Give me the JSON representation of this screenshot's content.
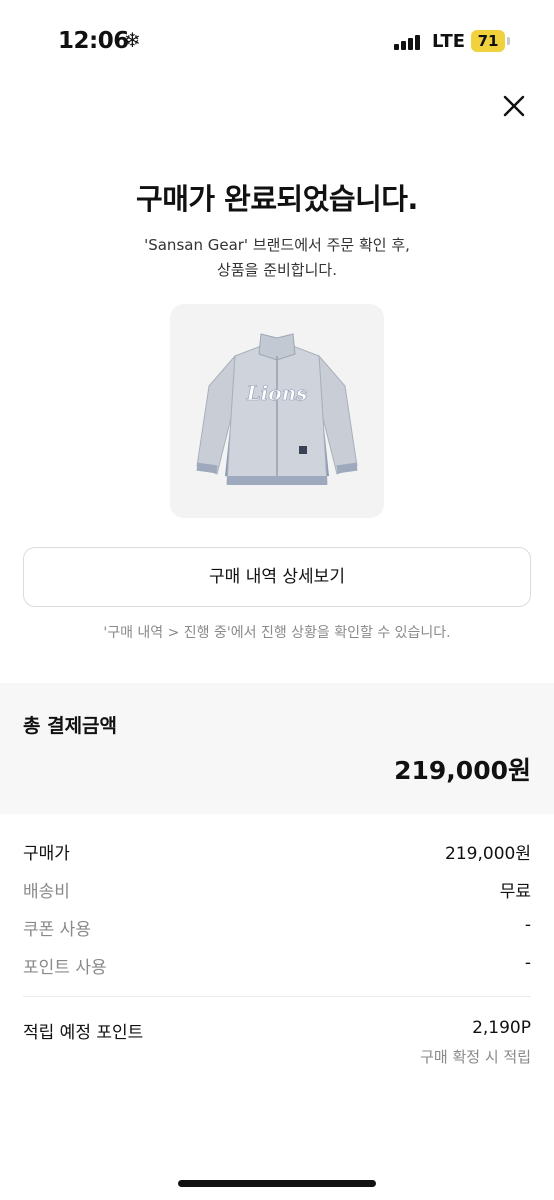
{
  "status_bar": {
    "time": "12:06",
    "network": "LTE",
    "battery": "71",
    "icons": [
      "snowflake-icon",
      "signal-icon",
      "battery-icon"
    ]
  },
  "header": {
    "close_icon": "close-icon"
  },
  "confirmation": {
    "title": "구매가 완료되었습니다.",
    "subtitle_line1": "'Sansan Gear' 브랜드에서 주문 확인 후,",
    "subtitle_line2": "상품을 준비합니다."
  },
  "product": {
    "image": "jacket-product-image",
    "logo_text": "Lions"
  },
  "actions": {
    "detail_button_label": "구매 내역 상세보기",
    "hint": "'구매 내역 > 진행 중'에서 진행 상황을 확인할 수 있습니다."
  },
  "total": {
    "label": "총 결제금액",
    "value": "219,000원"
  },
  "breakdown": [
    {
      "label": "구매가",
      "value": "219,000원"
    },
    {
      "label": "배송비",
      "value": "무료"
    },
    {
      "label": "쿠폰 사용",
      "value": "-"
    },
    {
      "label": "포인트 사용",
      "value": "-"
    }
  ],
  "points": {
    "label": "적립 예정 포인트",
    "value": "2,190P",
    "note": "구매 확정 시 적립"
  },
  "colors": {
    "text": "#111111",
    "muted": "#8a8a8a",
    "section_bg": "#f7f7f7",
    "battery": "#f2d23c"
  }
}
